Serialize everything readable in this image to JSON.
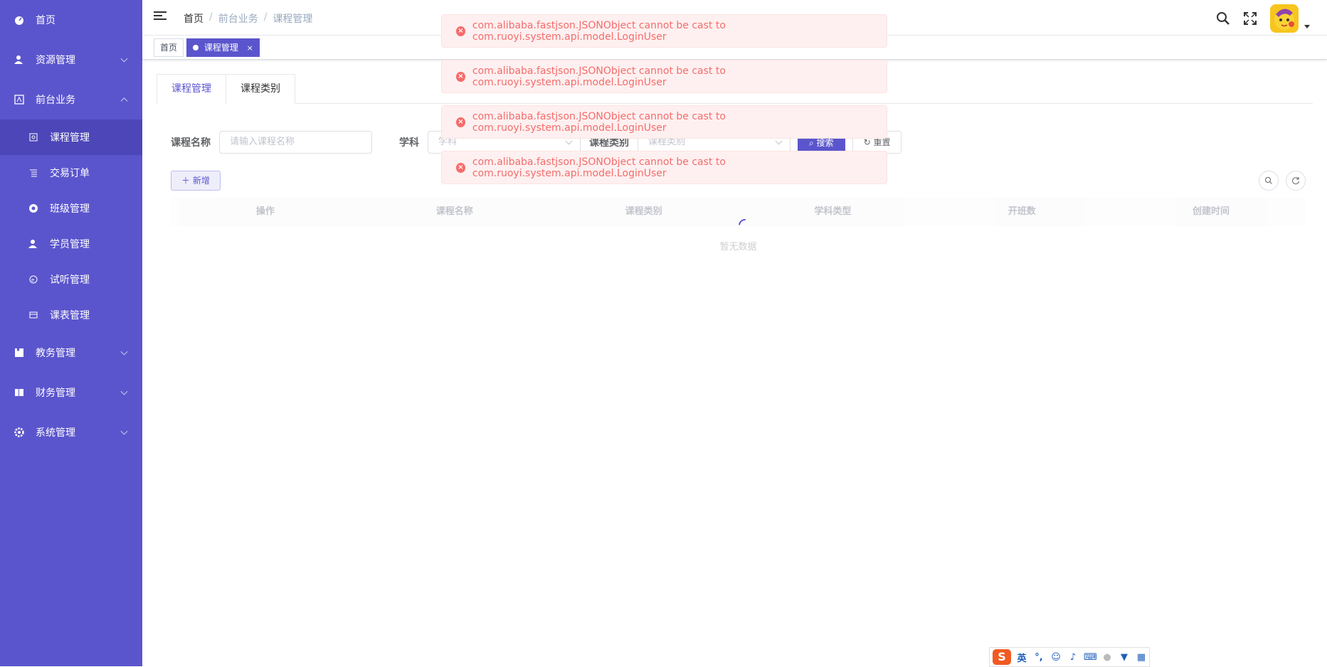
{
  "sidebar": {
    "items": [
      {
        "label": "首页",
        "icon": "dashboard-icon"
      },
      {
        "label": "资源管理",
        "icon": "user-icon"
      },
      {
        "label": "前台业务",
        "icon": "layout-icon"
      },
      {
        "label": "教务管理",
        "icon": "book-icon"
      },
      {
        "label": "财务管理",
        "icon": "money-icon"
      },
      {
        "label": "系统管理",
        "icon": "gear-icon"
      }
    ],
    "sub_items": [
      {
        "label": "课程管理",
        "icon": "course-icon"
      },
      {
        "label": "交易订单",
        "icon": "list-icon"
      },
      {
        "label": "班级管理",
        "icon": "class-icon"
      },
      {
        "label": "学员管理",
        "icon": "student-icon"
      },
      {
        "label": "试听管理",
        "icon": "audit-icon"
      },
      {
        "label": "课表管理",
        "icon": "calendar-icon"
      }
    ]
  },
  "navbar": {
    "breadcrumb": [
      "首页",
      "前台业务",
      "课程管理"
    ],
    "separator": "/"
  },
  "tags": {
    "home": "首页",
    "active": "课程管理",
    "close": "×"
  },
  "tabs": [
    "课程管理",
    "课程类别"
  ],
  "search": {
    "name_label": "课程名称",
    "name_placeholder": "请输入课程名称",
    "subject_label": "学科",
    "subject_placeholder": "学科",
    "category_label": "课程类别",
    "category_placeholder": "课程类别",
    "search_button": "搜索",
    "reset_button": "重置"
  },
  "toolbar": {
    "add_button": "新增"
  },
  "table": {
    "columns": [
      "操作",
      "课程名称",
      "课程类别",
      "学科类型",
      "开班数",
      "创建时间"
    ],
    "empty_text": "暂无数据"
  },
  "messages": [
    "com.alibaba.fastjson.JSONObject cannot be cast to com.ruoyi.system.api.model.LoginUser",
    "com.alibaba.fastjson.JSONObject cannot be cast to com.ruoyi.system.api.model.LoginUser",
    "com.alibaba.fastjson.JSONObject cannot be cast to com.ruoyi.system.api.model.LoginUser",
    "com.alibaba.fastjson.JSONObject cannot be cast to com.ruoyi.system.api.model.LoginUser"
  ],
  "ime": {
    "logo": "S",
    "lang": "英"
  },
  "colors": {
    "sidebar": "#5b55cd",
    "primary": "#5b55cd",
    "error": "#f56c6c"
  }
}
